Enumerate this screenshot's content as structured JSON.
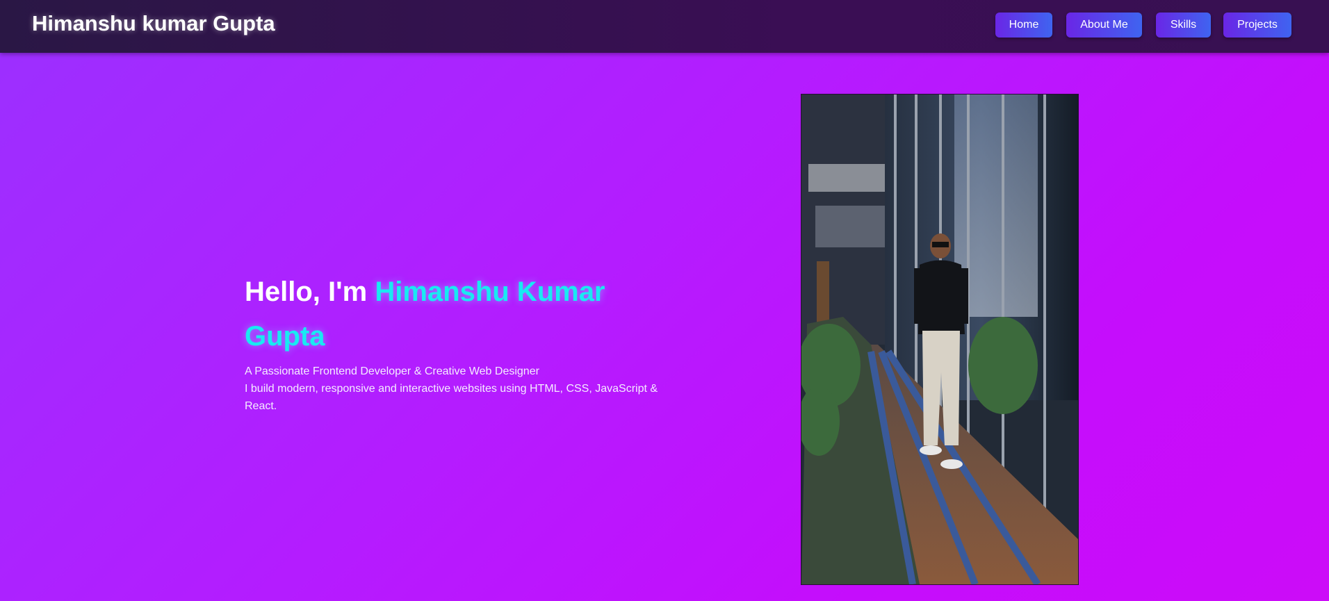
{
  "header": {
    "brand": "Himanshu kumar Gupta",
    "nav": [
      {
        "label": "Home"
      },
      {
        "label": "About Me"
      },
      {
        "label": "Skills"
      },
      {
        "label": "Projects"
      }
    ]
  },
  "hero": {
    "greeting": "Hello, I'm ",
    "name": "Himanshu Kumar Gupta",
    "tagline_line1": "A Passionate Frontend Developer & Creative Web Designer",
    "tagline_line2": "I build modern, responsive and interactive websites using HTML, CSS, JavaScript & React."
  },
  "colors": {
    "accent_name": "#18eaf2",
    "nav_button_start": "#6a26e6",
    "nav_button_end": "#3f64f0",
    "header_bg": "#2a1745",
    "page_bg": "#b41cff"
  }
}
